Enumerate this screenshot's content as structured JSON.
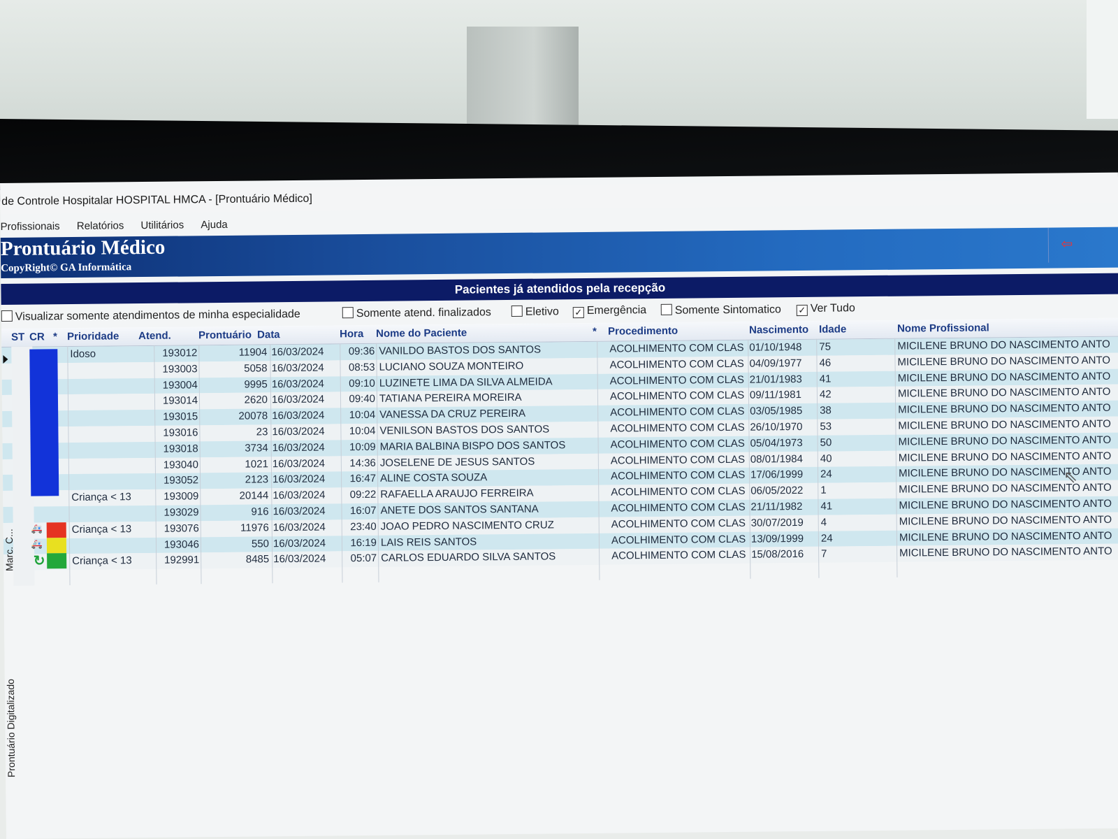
{
  "window": {
    "title": "de Controle Hospitalar HOSPITAL HMCA - [Prontuário Médico]",
    "menu": [
      "Profissionais",
      "Relatórios",
      "Utilitários",
      "Ajuda"
    ]
  },
  "banner": {
    "title": "Prontuário Médico",
    "copyright": "CopyRight© GA Informática",
    "nav_icon": "back-arrow-icon",
    "nav_symbol": "⇦"
  },
  "section": {
    "title": "Pacientes já atendidos pela recepção"
  },
  "filters": {
    "specialty": {
      "label": "Visualizar somente atendimentos de minha especialidade",
      "checked": false
    },
    "finalizados": {
      "label": "Somente atend. finalizados",
      "checked": false
    },
    "eletivo": {
      "label": "Eletivo",
      "checked": false
    },
    "emergencia": {
      "label": "Emergência",
      "checked": true
    },
    "sintomatico": {
      "label": "Somente Sintomatico",
      "checked": false
    },
    "ver_tudo": {
      "label": "Ver Tudo",
      "checked": true
    }
  },
  "table": {
    "headers": {
      "st": "ST",
      "cr": "CR",
      "star": "*",
      "prioridade": "Prioridade",
      "atend": "Atend.",
      "prontuario": "Prontuário",
      "data": "Data",
      "hora": "Hora",
      "nome": "Nome do Paciente",
      "star2": "*",
      "procedimento": "Procedimento",
      "nascimento": "Nascimento",
      "idade": "Idade",
      "profissional": "Nome Profissional"
    },
    "rows": [
      {
        "prioridade": "Idoso",
        "atend": "193012",
        "prontuario": "11904",
        "data": "16/03/2024",
        "hora": "09:36",
        "nome": "VANILDO BASTOS DOS SANTOS",
        "procedimento": "ACOLHIMENTO COM CLAS",
        "nascimento": "01/10/1948",
        "idade": "75",
        "profissional": "MICILENE BRUNO DO NASCIMENTO ANTO"
      },
      {
        "prioridade": "",
        "atend": "193003",
        "prontuario": "5058",
        "data": "16/03/2024",
        "hora": "08:53",
        "nome": "LUCIANO SOUZA MONTEIRO",
        "procedimento": "ACOLHIMENTO COM CLAS",
        "nascimento": "04/09/1977",
        "idade": "46",
        "profissional": "MICILENE BRUNO DO NASCIMENTO ANTO"
      },
      {
        "prioridade": "",
        "atend": "193004",
        "prontuario": "9995",
        "data": "16/03/2024",
        "hora": "09:10",
        "nome": "LUZINETE LIMA DA SILVA ALMEIDA",
        "procedimento": "ACOLHIMENTO COM CLAS",
        "nascimento": "21/01/1983",
        "idade": "41",
        "profissional": "MICILENE BRUNO DO NASCIMENTO ANTO"
      },
      {
        "prioridade": "",
        "atend": "193014",
        "prontuario": "2620",
        "data": "16/03/2024",
        "hora": "09:40",
        "nome": "TATIANA PEREIRA MOREIRA",
        "procedimento": "ACOLHIMENTO COM CLAS",
        "nascimento": "09/11/1981",
        "idade": "42",
        "profissional": "MICILENE BRUNO DO NASCIMENTO ANTO"
      },
      {
        "prioridade": "",
        "atend": "193015",
        "prontuario": "20078",
        "data": "16/03/2024",
        "hora": "10:04",
        "nome": "VANESSA DA CRUZ PEREIRA",
        "procedimento": "ACOLHIMENTO COM CLAS",
        "nascimento": "03/05/1985",
        "idade": "38",
        "profissional": "MICILENE BRUNO DO NASCIMENTO ANTO"
      },
      {
        "prioridade": "",
        "atend": "193016",
        "prontuario": "23",
        "data": "16/03/2024",
        "hora": "10:04",
        "nome": "VENILSON BASTOS DOS SANTOS",
        "procedimento": "ACOLHIMENTO COM CLAS",
        "nascimento": "26/10/1970",
        "idade": "53",
        "profissional": "MICILENE BRUNO DO NASCIMENTO ANTO"
      },
      {
        "prioridade": "",
        "atend": "193018",
        "prontuario": "3734",
        "data": "16/03/2024",
        "hora": "10:09",
        "nome": "MARIA BALBINA BISPO DOS SANTOS",
        "procedimento": "ACOLHIMENTO COM CLAS",
        "nascimento": "05/04/1973",
        "idade": "50",
        "profissional": "MICILENE BRUNO DO NASCIMENTO ANTO"
      },
      {
        "prioridade": "",
        "atend": "193040",
        "prontuario": "1021",
        "data": "16/03/2024",
        "hora": "14:36",
        "nome": "JOSELENE DE JESUS SANTOS",
        "procedimento": "ACOLHIMENTO COM CLAS",
        "nascimento": "08/01/1984",
        "idade": "40",
        "profissional": "MICILENE BRUNO DO NASCIMENTO ANTO"
      },
      {
        "prioridade": "",
        "atend": "193052",
        "prontuario": "2123",
        "data": "16/03/2024",
        "hora": "16:47",
        "nome": "ALINE COSTA SOUZA",
        "procedimento": "ACOLHIMENTO COM CLAS",
        "nascimento": "17/06/1999",
        "idade": "24",
        "profissional": "MICILENE BRUNO DO NASCIMENTO ANTO"
      },
      {
        "prioridade": "Criança < 13",
        "atend": "193009",
        "prontuario": "20144",
        "data": "16/03/2024",
        "hora": "09:22",
        "nome": "RAFAELLA ARAUJO FERREIRA",
        "procedimento": "ACOLHIMENTO COM CLAS",
        "nascimento": "06/05/2022",
        "idade": "1",
        "profissional": "MICILENE BRUNO DO NASCIMENTO ANTO"
      },
      {
        "prioridade": "",
        "atend": "193029",
        "prontuario": "916",
        "data": "16/03/2024",
        "hora": "16:07",
        "nome": "ANETE DOS SANTOS SANTANA",
        "procedimento": "ACOLHIMENTO COM CLAS",
        "nascimento": "21/11/1982",
        "idade": "41",
        "profissional": "MICILENE BRUNO DO NASCIMENTO ANTO"
      },
      {
        "prioridade": "Criança < 13",
        "atend": "193076",
        "prontuario": "11976",
        "data": "16/03/2024",
        "hora": "23:40",
        "nome": "JOAO PEDRO NASCIMENTO CRUZ",
        "procedimento": "ACOLHIMENTO COM CLAS",
        "nascimento": "30/07/2019",
        "idade": "4",
        "profissional": "MICILENE BRUNO DO NASCIMENTO ANTO"
      },
      {
        "prioridade": "",
        "atend": "193046",
        "prontuario": "550",
        "data": "16/03/2024",
        "hora": "16:19",
        "nome": "LAIS REIS SANTOS",
        "procedimento": "ACOLHIMENTO COM CLAS",
        "nascimento": "13/09/1999",
        "idade": "24",
        "profissional": "MICILENE BRUNO DO NASCIMENTO ANTO"
      },
      {
        "prioridade": "Criança < 13",
        "atend": "192991",
        "prontuario": "8485",
        "data": "16/03/2024",
        "hora": "05:07",
        "nome": "CARLOS EDUARDO SILVA SANTOS",
        "procedimento": "ACOLHIMENTO COM CLAS",
        "nascimento": "15/08/2016",
        "idade": "7",
        "profissional": "MICILENE BRUNO DO NASCIMENTO ANTO"
      }
    ]
  },
  "status_icons": {
    "ambulance_icon": "ambulance-icon",
    "ambulance_symbol": "🚑",
    "refresh_icon": "refresh-icon",
    "refresh_symbol": "↻",
    "colors": {
      "blue": "#1233d9",
      "red": "#e53322",
      "yellow": "#e8e020",
      "green": "#22a83a"
    }
  },
  "side_tabs": [
    "Marc. C...",
    "Prontuário Digitalizado"
  ]
}
